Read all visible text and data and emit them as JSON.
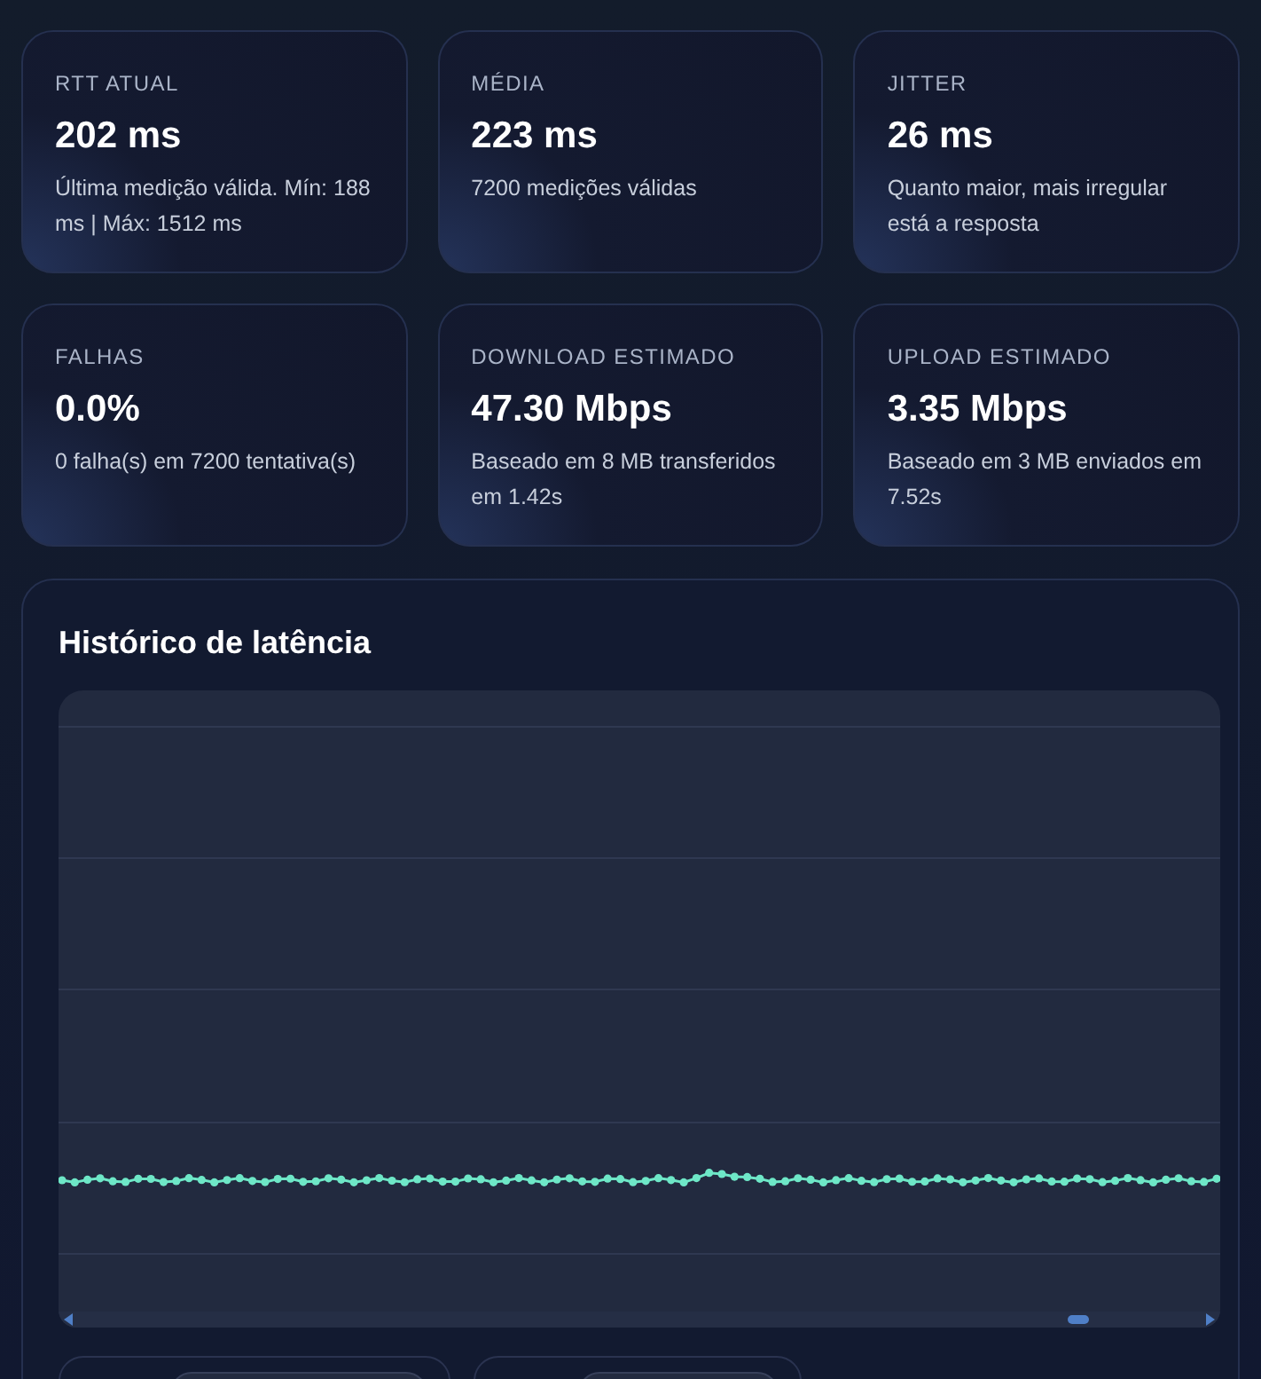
{
  "stats": [
    {
      "label": "RTT ATUAL",
      "value": "202 ms",
      "detail": "Última medição válida. Mín: 188 ms | Máx: 1512 ms"
    },
    {
      "label": "MÉDIA",
      "value": "223 ms",
      "detail": "7200 medições válidas"
    },
    {
      "label": "JITTER",
      "value": "26 ms",
      "detail": "Quanto maior, mais irregular está a resposta"
    },
    {
      "label": "FALHAS",
      "value": "0.0%",
      "detail": "0 falha(s) em 7200 tentativa(s)"
    },
    {
      "label": "DOWNLOAD ESTIMADO",
      "value": "47.30 Mbps",
      "detail": "Baseado em 8 MB transferidos em 1.42s"
    },
    {
      "label": "UPLOAD ESTIMADO",
      "value": "3.35 Mbps",
      "detail": "Baseado em 3 MB enviados em 7.52s"
    }
  ],
  "history": {
    "title": "Histórico de latência"
  }
}
